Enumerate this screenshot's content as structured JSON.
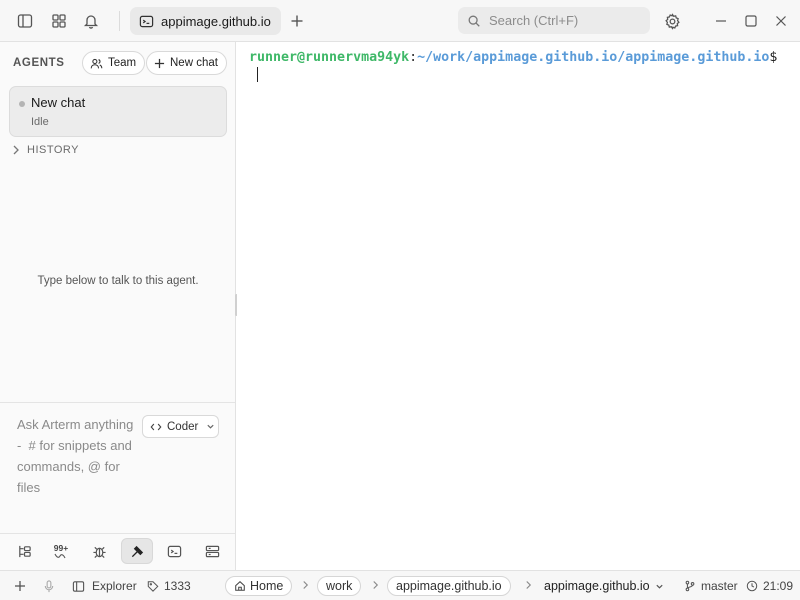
{
  "titlebar": {
    "icons": [
      "sidebar-toggle-icon",
      "apps-grid-icon",
      "bell-icon"
    ],
    "tab": {
      "label": "appimage.github.io",
      "icon": "terminal-tab-icon"
    },
    "new_tab_icon": "plus-icon",
    "search": {
      "placeholder": "Search (Ctrl+F)",
      "value": ""
    },
    "window_controls": [
      "gear-icon",
      "minimize-icon",
      "maximize-icon",
      "close-icon"
    ]
  },
  "sidebar": {
    "header": "AGENTS",
    "team_label": "Team",
    "new_chat_label": "New chat",
    "agent": {
      "name": "New chat",
      "status": "Idle"
    },
    "history_label": "HISTORY",
    "empty_message": "Type below to talk to this agent.",
    "composer": {
      "placeholder": "Ask Arterm anything  -  # for snippets and commands, @ for files",
      "mode_label": "Coder"
    },
    "tools": [
      {
        "name": "tree-icon",
        "active": false
      },
      {
        "name": "notifications-badge",
        "badge": "99+",
        "active": false
      },
      {
        "name": "bug-icon",
        "active": false
      },
      {
        "name": "agent-icon",
        "active": true
      },
      {
        "name": "terminal-icon",
        "active": false
      },
      {
        "name": "panels-icon",
        "active": false
      }
    ]
  },
  "terminal": {
    "user": "runner@runnervma94yk",
    "colon": ":",
    "path": "~/work/appimage.github.io/appimage.github.io",
    "prompt": "$"
  },
  "statusbar": {
    "explorer_label": "Explorer",
    "count": "1333",
    "breadcrumbs": [
      "Home",
      "work",
      "appimage.github.io"
    ],
    "current": "appimage.github.io",
    "branch": "master",
    "time": "21:09"
  },
  "colors": {
    "prompt_user": "#3fb868",
    "prompt_path": "#5a9bd8",
    "active_tab_bg": "#e9e9e9"
  }
}
